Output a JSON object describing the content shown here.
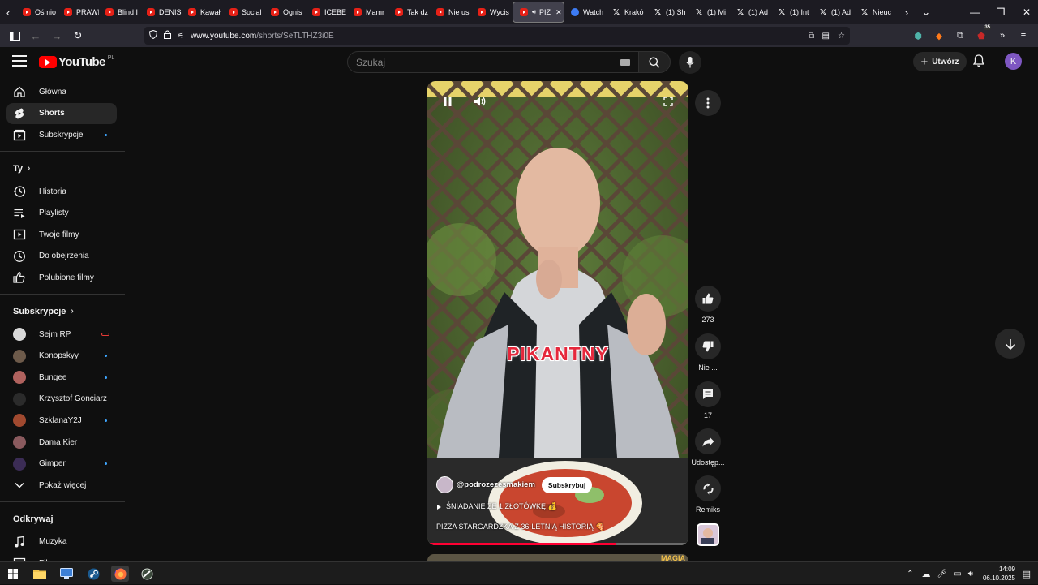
{
  "browser": {
    "tabs": [
      {
        "label": "Ośmio",
        "icon": "youtube-icon"
      },
      {
        "label": "PRAWI",
        "icon": "youtube-icon"
      },
      {
        "label": "Blind I",
        "icon": "youtube-icon"
      },
      {
        "label": "DENIS",
        "icon": "youtube-icon"
      },
      {
        "label": "Kawał",
        "icon": "youtube-icon"
      },
      {
        "label": "Social",
        "icon": "youtube-icon"
      },
      {
        "label": "Ognis",
        "icon": "youtube-icon"
      },
      {
        "label": "ICEBE",
        "icon": "youtube-icon"
      },
      {
        "label": "Mamr",
        "icon": "youtube-icon"
      },
      {
        "label": "Tak dz",
        "icon": "youtube-icon"
      },
      {
        "label": "Nie us",
        "icon": "youtube-icon"
      },
      {
        "label": "Wycis",
        "icon": "youtube-icon"
      },
      {
        "label": "PIZ",
        "icon": "youtube-icon"
      },
      {
        "label": "Watch",
        "icon": "watch-icon"
      },
      {
        "label": "Krakó",
        "icon": "x-icon"
      },
      {
        "label": "(1) Sh",
        "icon": "x-icon"
      },
      {
        "label": "(1) Mi",
        "icon": "x-icon"
      },
      {
        "label": "(1) Ad",
        "icon": "x-icon"
      },
      {
        "label": "(1) Int",
        "icon": "x-icon"
      },
      {
        "label": "(1) Ad",
        "icon": "x-icon"
      },
      {
        "label": "Nieuc",
        "icon": "x-icon"
      }
    ],
    "url_domain": "www.youtube.com",
    "url_path": "/shorts/SeTLTHZ3i0E",
    "extension_badge": "35"
  },
  "header": {
    "logo_text": "YouTube",
    "logo_region": "PL",
    "search_placeholder": "Szukaj",
    "create_label": "Utwórz",
    "avatar_letter": "K"
  },
  "sidebar": {
    "main": [
      {
        "label": "Główna",
        "icon": "home-icon"
      },
      {
        "label": "Shorts",
        "icon": "shorts-icon"
      },
      {
        "label": "Subskrypcje",
        "icon": "subscriptions-icon"
      }
    ],
    "you_header": "Ty",
    "you": [
      {
        "label": "Historia",
        "icon": "history-icon"
      },
      {
        "label": "Playlisty",
        "icon": "playlists-icon"
      },
      {
        "label": "Twoje filmy",
        "icon": "your-videos-icon"
      },
      {
        "label": "Do obejrzenia",
        "icon": "watch-later-icon"
      },
      {
        "label": "Polubione filmy",
        "icon": "liked-icon"
      }
    ],
    "subs_header": "Subskrypcje",
    "subscriptions": [
      {
        "label": "Sejm RP",
        "color": "#d9d9d9",
        "badge": "live"
      },
      {
        "label": "Konopskyy",
        "color": "#6d5a4a",
        "badge": "dot"
      },
      {
        "label": "Bungee",
        "color": "#b0625e",
        "badge": "dot"
      },
      {
        "label": "Krzysztof Gonciarz",
        "color": "#2b2b2b",
        "badge": ""
      },
      {
        "label": "SzklanaY2J",
        "color": "#a0492f",
        "badge": "dot"
      },
      {
        "label": "Dama Kier",
        "color": "#8a5a5e",
        "badge": ""
      },
      {
        "label": "Gimper",
        "color": "#3b2c55",
        "badge": "dot"
      }
    ],
    "show_more": "Pokaż więcej",
    "explore_header": "Odkrywaj",
    "explore": [
      {
        "label": "Muzyka",
        "icon": "music-icon"
      },
      {
        "label": "Filmy",
        "icon": "movies-icon"
      }
    ]
  },
  "short": {
    "overlay_text": "PIKANTNY",
    "channel": "@podrozezesmakiem",
    "subscribe_label": "Subskrybuj",
    "playlist": "ŚNIADANIE ZE 1 ZŁOTÓWKĘ 💰",
    "title": "PIZZA STARGARDZKA Z 36-LETNIĄ HISTORIĄ 🍕",
    "progress": 0.72,
    "next_tag": "MAGIA"
  },
  "actions": {
    "likes": "273",
    "dislike_label": "Nie ...",
    "comments": "17",
    "share_label": "Udostęp...",
    "remix_label": "Remiks"
  },
  "taskbar": {
    "time": "14:09",
    "date": "06.10.2025"
  }
}
